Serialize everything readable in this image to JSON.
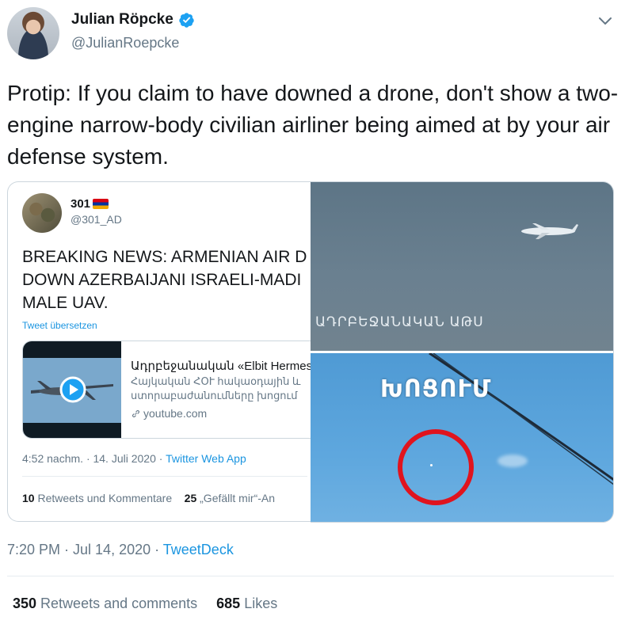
{
  "author": {
    "name": "Julian Röpcke",
    "handle": "@JulianRoepcke",
    "verified_icon": "verified-badge-icon",
    "menu_icon": "chevron-down-icon"
  },
  "tweet": {
    "text": "Protip: If you claim to have downed a drone, don't show a two-engine narrow-body civilian airliner being aimed at by your air defense system."
  },
  "quoted_tweet": {
    "name": "301",
    "flag_icon": "armenia-flag-icon",
    "handle": "@301_AD",
    "text": "BREAKING NEWS: ARMENIAN AIR D\nDOWN AZERBAIJANI ISRAELI-MADI\nMALE UAV.",
    "translate_label": "Tweet übersetzen",
    "link_card": {
      "title": "Ադրբեջանական «Elbit Hermes",
      "description": "Հայկական ՀՕՒ հակաօդային և\nստորաբաժանումները խոցում",
      "domain": "youtube.com"
    },
    "meta_time": "4:52 nachm. · 14. Juli 2020 · ",
    "meta_app": "Twitter Web App",
    "retweets_count": "10",
    "retweets_label": " Retweets und Kommentare",
    "likes_count": "25",
    "likes_label": " „Gefällt mir“-An"
  },
  "media": {
    "top_caption": "ԱԴՐԲԵՋԱՆԱԿԱՆ ԱԹՍ",
    "bottom_caption": "ԽՈՑՈՒՄ"
  },
  "footer": {
    "time": "7:20 PM · Jul 14, 2020 · ",
    "app": "TweetDeck",
    "retweets_count": "350",
    "retweets_label": " Retweets and comments",
    "likes_count": "685",
    "likes_label": " Likes"
  },
  "colors": {
    "link_blue": "#1b95e0",
    "muted": "#657786",
    "text": "#14171a",
    "target_red": "#e0141e"
  }
}
